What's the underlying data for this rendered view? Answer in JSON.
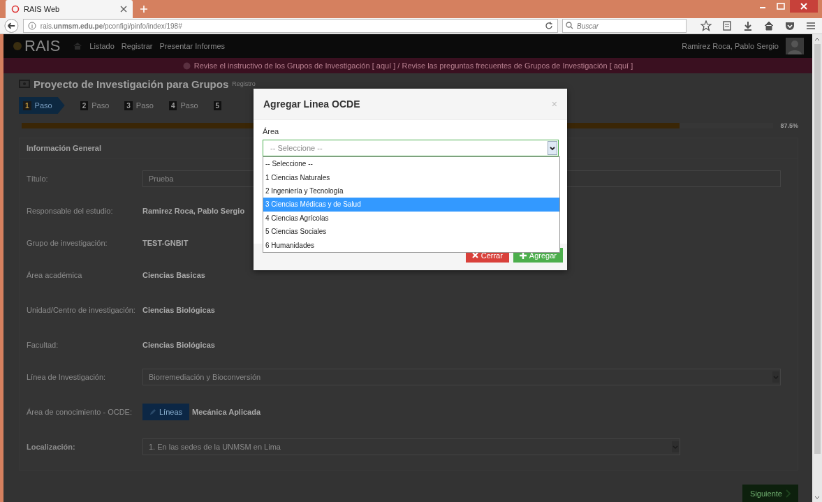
{
  "browser": {
    "tab_title": "RAIS Web",
    "url": "rais.**unmsm.edu.pe**/pconfigi/pinfo/index/198#",
    "search": {
      "placeholder": "Buscar"
    }
  },
  "navbar": {
    "logo": "RAIS",
    "menus": [
      {
        "label": "Listado"
      },
      {
        "label": "Registrar"
      },
      {
        "label": "Presentar Informes"
      }
    ],
    "user": "Ramirez Roca, Pablo Sergio"
  },
  "banner": {
    "text": "Revise el instructivo de los Grupos de Investigación [ aquí ] / Revise las preguntas frecuentes de Grupos de Investigación [ aquí ]"
  },
  "page": {
    "title": "Proyecto de Investigación para Grupos",
    "subtitle": "Registro"
  },
  "steps": [
    {
      "number": "1",
      "label": "Paso",
      "selected": true
    },
    {
      "number": "2",
      "label": "Paso",
      "selected": false
    },
    {
      "number": "3",
      "label": "Paso",
      "selected": false
    },
    {
      "number": "4",
      "label": "Paso",
      "selected": false
    },
    {
      "number": "5",
      "selected": false
    }
  ],
  "progress": {
    "level": 0.875,
    "reading": "87.5%"
  },
  "panel": {
    "title": "Información General",
    "rows": [
      {
        "label": "Título:",
        "kind": "input",
        "value": "Prueba"
      },
      {
        "label": "Responsable del estudio:",
        "kind": "text",
        "value": "Ramirez Roca, Pablo Sergio"
      },
      {
        "label": "Grupo de investigación:",
        "kind": "text",
        "value": "TEST-GNBIT"
      },
      {
        "label": "Área académica",
        "kind": "text",
        "value": "Ciencias Basicas"
      },
      {
        "label": "Unidad/Centro de investigación:",
        "kind": "text",
        "value": "Ciencias Biológicas"
      },
      {
        "label": "Facultad:",
        "kind": "text",
        "value": "Ciencias Biológicas"
      },
      {
        "label": "Línea de Investigación:",
        "kind": "select",
        "value": "Biorremediación y Bioconversión"
      },
      {
        "label": "Área de conocimiento - OCDE:",
        "kind": "button",
        "button": "Líneas",
        "value": "Mecánica Aplicada"
      },
      {
        "label": "Localización:",
        "kind": "select-short",
        "value": "1. En las sedes de la UNMSM en Lima"
      }
    ]
  },
  "next_button": "Siguiente",
  "modal": {
    "title": "Agregar Linea OCDE",
    "close": "×",
    "field_label": "Área",
    "select_value": "-- Seleccione --",
    "options": [
      {
        "label": "-- Seleccione --",
        "selected": false
      },
      {
        "label": "1 Ciencias Naturales",
        "selected": false
      },
      {
        "label": "2 Ingeniería y Tecnología",
        "selected": false
      },
      {
        "label": "3 Ciencias Médicas y de Salud",
        "selected": true
      },
      {
        "label": "4 Ciencias Agrícolas",
        "selected": false
      },
      {
        "label": "5 Ciencias Sociales",
        "selected": false
      },
      {
        "label": "6 Humanidades",
        "selected": false
      }
    ],
    "buttons": [
      {
        "kind": "close",
        "label": "Cerrar"
      },
      {
        "kind": "add",
        "label": "Agregar"
      }
    ]
  }
}
